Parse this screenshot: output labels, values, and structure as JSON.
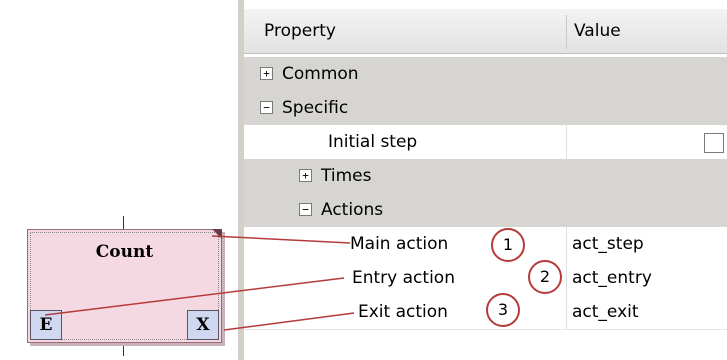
{
  "property_grid": {
    "headers": {
      "property": "Property",
      "value": "Value"
    },
    "rows": [
      {
        "label": "Common",
        "kind": "group",
        "expanded": false,
        "toggle": "+"
      },
      {
        "label": "Specific",
        "kind": "group",
        "expanded": true,
        "toggle": "−"
      },
      {
        "label": "Initial step",
        "kind": "property",
        "value": "",
        "checkbox": true
      },
      {
        "label": "Times",
        "kind": "group",
        "expanded": false,
        "toggle": "+"
      },
      {
        "label": "Actions",
        "kind": "group",
        "expanded": true,
        "toggle": "−"
      },
      {
        "label": "Main action",
        "kind": "property",
        "value": "act_step",
        "callout": "1"
      },
      {
        "label": "Entry action",
        "kind": "property",
        "value": "act_entry",
        "callout": "2"
      },
      {
        "label": "Exit action",
        "kind": "property",
        "value": "act_exit",
        "callout": "3"
      }
    ]
  },
  "step_block": {
    "title": "Count",
    "entry_port": "E",
    "exit_port": "X"
  },
  "colors": {
    "step_fill": "#f5d9e2",
    "port_fill": "#cfd8f0",
    "callout_ring": "#b53b3b",
    "connector": "#b53b3b",
    "group_row": "#d7d5d2"
  }
}
